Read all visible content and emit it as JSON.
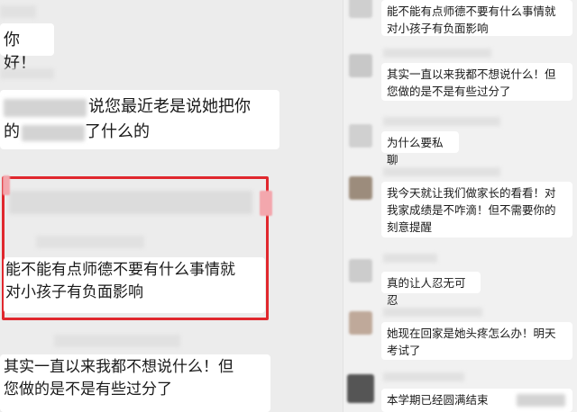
{
  "left_chat": {
    "messages": [
      {
        "text": "你好！"
      },
      {
        "line1": "说您最近老是说她把你",
        "line2_start": "的",
        "line2_end": "了什么的"
      },
      {
        "text1": "能不能有点师德不要有什么事情就",
        "text2": "对小孩子有负面影响"
      },
      {
        "text1": "其实一直以来我都不想说什么！但",
        "text2": "您做的是不是有些过分了"
      }
    ]
  },
  "right_chat": {
    "messages": [
      {
        "line1": "能不能有点师德不要有什么事情就",
        "line2": "对小孩子有负面影响"
      },
      {
        "line1": "其实一直以来我都不想说什么！但",
        "line2": "您做的是不是有些过分了"
      },
      {
        "text": "为什么要私聊"
      },
      {
        "line1": "我今天就让我们做家长的看看！对",
        "line2": "我家成绩是不咋滴！但不需要你的",
        "line3": "刻意提醒"
      },
      {
        "text": "真的让人忍无可忍"
      },
      {
        "line1": "她现在回家是她头疼怎么办！明天",
        "line2": "考试了"
      },
      {
        "text": "本学期已经圆满结束"
      }
    ]
  },
  "colors": {
    "highlight": "#e0282e",
    "bubble": "#ffffff",
    "background": "#ececec"
  }
}
